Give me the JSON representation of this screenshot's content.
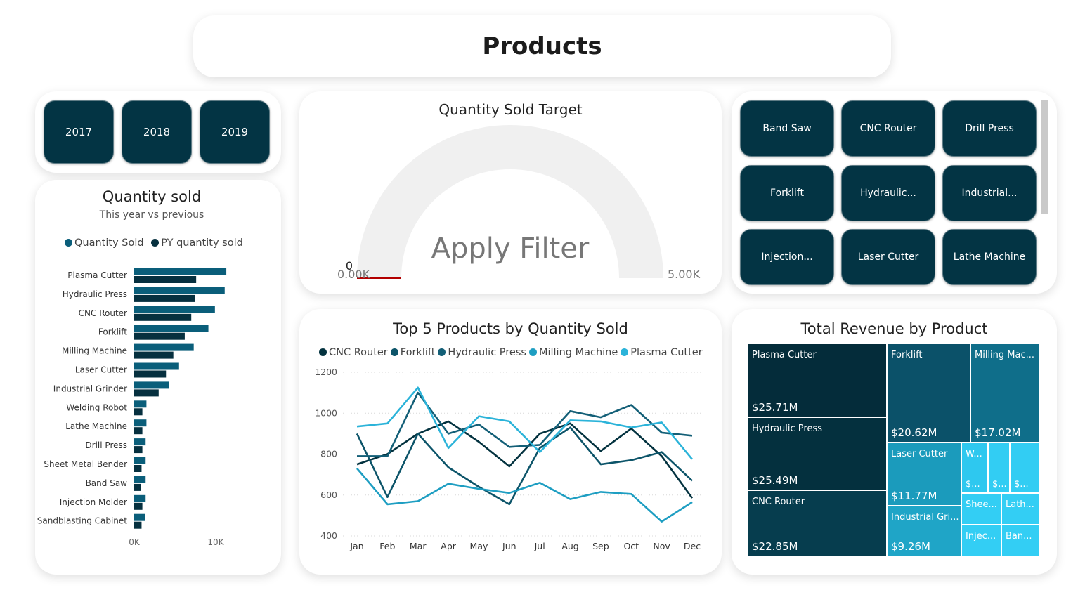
{
  "page": {
    "title": "Products"
  },
  "colors": {
    "dark": "#033444",
    "qty": "#0a5e7a",
    "py": "#06303f",
    "gauge_bg": "#f0f0f0",
    "target_line": "#b30000"
  },
  "years": [
    "2017",
    "2018",
    "2019"
  ],
  "products_slicer": [
    "Band Saw",
    "CNC Router",
    "Drill Press",
    "Forklift",
    "Hydraulic...",
    "Industrial...",
    "Injection...",
    "Laser Cutter",
    "Lathe Machine"
  ],
  "gauge": {
    "title": "Quantity Sold Target",
    "overlay": "Apply Filter",
    "min_label": "0.00K",
    "max_label": "5.00K",
    "value_label": "0",
    "value": 0,
    "min": 0,
    "max": 5000
  },
  "bar_panel": {
    "title": "Quantity sold",
    "subtitle": "This year vs previous",
    "legend": [
      {
        "name": "Quantity Sold",
        "color": "#0a5e7a"
      },
      {
        "name": "PY quantity sold",
        "color": "#06303f"
      }
    ]
  },
  "line_panel": {
    "title": "Top 5 Products by Quantity Sold",
    "legend": [
      "CNC Router",
      "Forklift",
      "Hydraulic Press",
      "Milling Machine",
      "Plasma Cutter"
    ]
  },
  "treemap": {
    "title": "Total Revenue by Product",
    "cells": [
      {
        "name": "Plasma Cutter",
        "value": "$25.71M",
        "color": "#042c3a"
      },
      {
        "name": "Hydraulic Press",
        "value": "$25.49M",
        "color": "#04303e"
      },
      {
        "name": "CNC Router",
        "value": "$22.85M",
        "color": "#063d4e"
      },
      {
        "name": "Forklift",
        "value": "$20.62M",
        "color": "#0b5169"
      },
      {
        "name": "Milling Mac...",
        "value": "$17.02M",
        "color": "#0f6e8a"
      },
      {
        "name": "Laser Cutter",
        "value": "$11.77M",
        "color": "#1b9bbc"
      },
      {
        "name": "Industrial Gri...",
        "value": "$9.26M",
        "color": "#1fa5c7"
      },
      {
        "name": "W...",
        "value": "$...",
        "color": "#2ec8ef"
      },
      {
        "name": "",
        "value": "$...",
        "color": "#32cdf3"
      },
      {
        "name": "",
        "value": "$...",
        "color": "#32cdf3"
      },
      {
        "name": "Shee...",
        "value": "",
        "color": "#33cef4"
      },
      {
        "name": "Lath...",
        "value": "",
        "color": "#33cef4"
      },
      {
        "name": "Injec...",
        "value": "",
        "color": "#33cef4"
      },
      {
        "name": "Ban...",
        "value": "",
        "color": "#33cef4"
      }
    ]
  },
  "chart_data": [
    {
      "type": "bar",
      "title": "Quantity sold",
      "subtitle": "This year vs previous",
      "orientation": "horizontal",
      "categories": [
        "Plasma Cutter",
        "Hydraulic Press",
        "CNC Router",
        "Forklift",
        "Milling Machine",
        "Laser Cutter",
        "Industrial Grinder",
        "Welding Robot",
        "Lathe Machine",
        "Drill Press",
        "Sheet Metal Bender",
        "Band Saw",
        "Injection Molder",
        "Sandblasting Cabinet"
      ],
      "series": [
        {
          "name": "Quantity Sold",
          "values": [
            11300,
            11100,
            9900,
            9100,
            7300,
            5500,
            4300,
            1500,
            1500,
            1400,
            1400,
            1400,
            1400,
            1300
          ]
        },
        {
          "name": "PY quantity sold",
          "values": [
            7600,
            7500,
            7000,
            6200,
            4800,
            3900,
            3000,
            1000,
            1000,
            1000,
            900,
            800,
            1000,
            900
          ]
        }
      ],
      "x_ticks": [
        "0K",
        "10K"
      ],
      "xlim": [
        0,
        11500
      ],
      "legend": "top"
    },
    {
      "type": "line",
      "title": "Top 5 Products by Quantity Sold",
      "x": [
        "Jan",
        "Feb",
        "Mar",
        "Apr",
        "May",
        "Jun",
        "Jul",
        "Aug",
        "Sep",
        "Oct",
        "Nov",
        "Dec"
      ],
      "ylim": [
        400,
        1200
      ],
      "y_ticks": [
        400,
        600,
        800,
        1000,
        1200
      ],
      "grid": true,
      "legend": "top",
      "series": [
        {
          "name": "CNC Router",
          "color": "#03323f",
          "values": [
            750,
            800,
            900,
            960,
            860,
            740,
            900,
            950,
            815,
            925,
            790,
            585
          ]
        },
        {
          "name": "Forklift",
          "color": "#0c5469",
          "values": [
            900,
            590,
            900,
            735,
            640,
            555,
            830,
            930,
            750,
            770,
            810,
            670
          ]
        },
        {
          "name": "Hydraulic Press",
          "color": "#135f77",
          "values": [
            790,
            790,
            1100,
            900,
            945,
            835,
            845,
            1010,
            980,
            1040,
            905,
            890
          ]
        },
        {
          "name": "Milling Machine",
          "color": "#1e9ec2",
          "values": [
            730,
            555,
            570,
            655,
            630,
            610,
            660,
            580,
            615,
            605,
            470,
            565
          ]
        },
        {
          "name": "Plasma Cutter",
          "color": "#2bb3d9",
          "values": [
            935,
            950,
            1125,
            830,
            985,
            960,
            810,
            965,
            960,
            930,
            955,
            775
          ]
        }
      ]
    },
    {
      "type": "treemap",
      "title": "Total Revenue by Product",
      "labels": [
        "Plasma Cutter",
        "Hydraulic Press",
        "CNC Router",
        "Forklift",
        "Milling Mac...",
        "Laser Cutter",
        "Industrial Gri..."
      ],
      "values": [
        25.71,
        25.49,
        22.85,
        20.62,
        17.02,
        11.77,
        9.26
      ],
      "unit": "$M"
    }
  ]
}
